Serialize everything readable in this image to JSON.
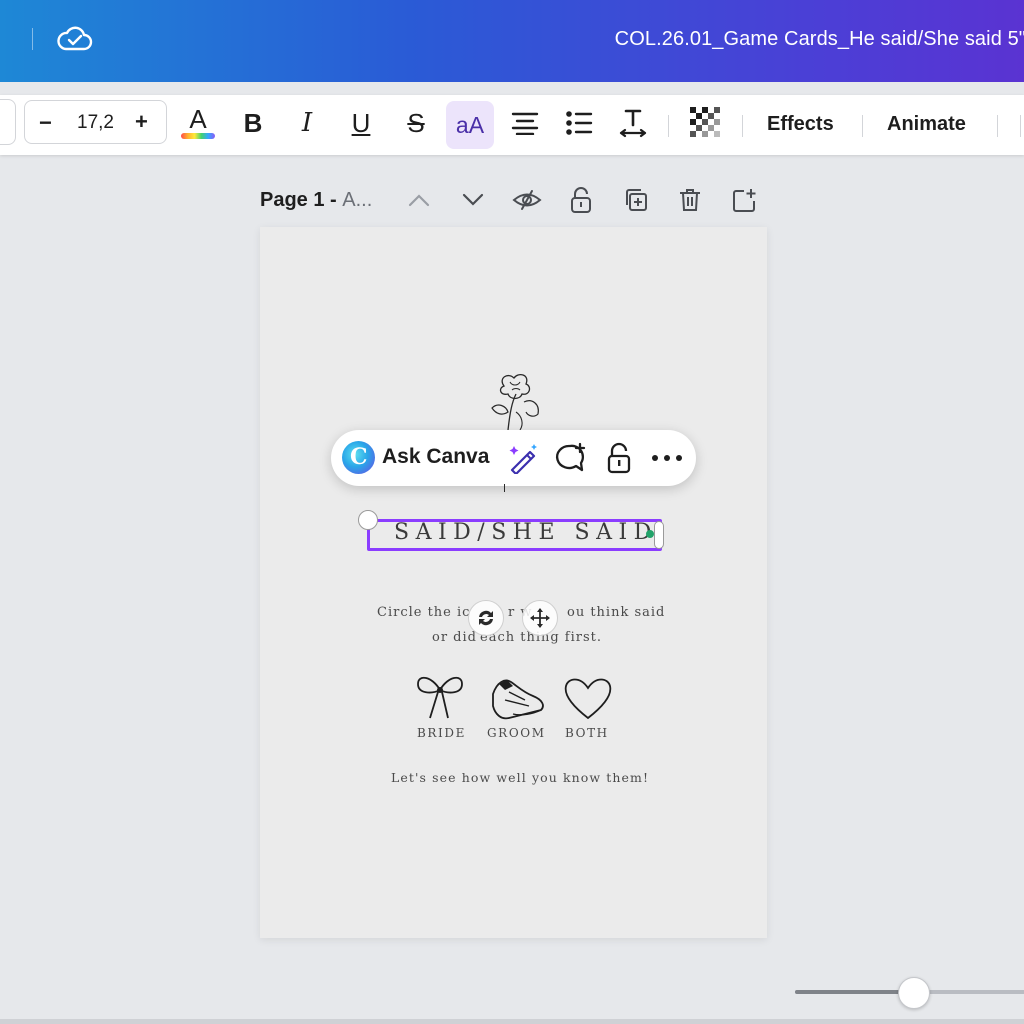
{
  "header": {
    "document_title": "COL.26.01_Game Cards_He said/She said 5\"",
    "icons": [
      "cloud-check-icon"
    ]
  },
  "toolbar": {
    "font_size": "17,2",
    "minus_label": "−",
    "plus_label": "+",
    "text_color_glyph": "A",
    "bold_glyph": "B",
    "italic_glyph": "I",
    "underline_glyph": "U",
    "strike_glyph": "S",
    "case_glyph": "aA",
    "effects_label": "Effects",
    "animate_label": "Animate",
    "accent_color": "#8b3dff"
  },
  "page_header": {
    "title": "Page 1 - ",
    "subtitle": "A..."
  },
  "ask_canva": {
    "logo_letter": "C",
    "label": "Ask Canva"
  },
  "card": {
    "selected_text": "SAID/SHE SAID",
    "instructions_line1": "Circle the ic",
    "instructions_line1b": "r w",
    "instructions_line1c": "ou think said",
    "instructions_line2a": "or did",
    "instructions_line2b": "each thing first.",
    "options": [
      "BRIDE",
      "GROOM",
      "BOTH"
    ],
    "footer": "Let's see how well you know them!"
  },
  "zoom": {
    "slider_level": 0.49
  }
}
